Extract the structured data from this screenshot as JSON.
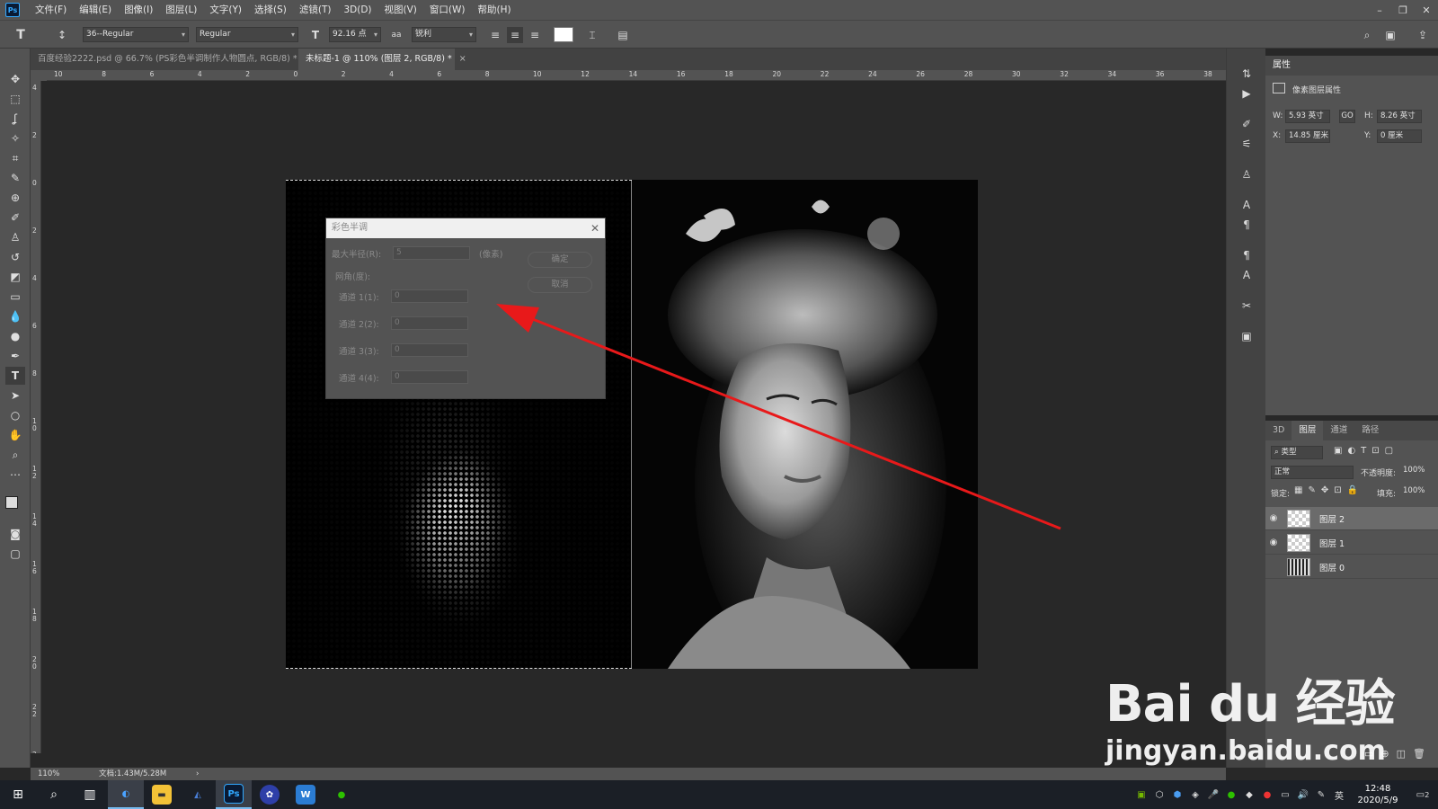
{
  "app": {
    "logo": "Ps",
    "title": ""
  },
  "menu": [
    "文件(F)",
    "编辑(E)",
    "图像(I)",
    "图层(L)",
    "文字(Y)",
    "选择(S)",
    "滤镜(T)",
    "3D(D)",
    "视图(V)",
    "窗口(W)",
    "帮助(H)"
  ],
  "window_controls": {
    "minimize": "–",
    "restore": "❐",
    "close": "✕"
  },
  "options": {
    "font_family": "36--Regular",
    "font_style": "Regular",
    "font_size": "92.16 点",
    "antialias": "锐利",
    "text_color": "#ffffff"
  },
  "tabs": [
    {
      "label": "百度经验2222.psd @ 66.7% (PS彩色半调制作人物圆点, RGB/8) *",
      "close": "×"
    },
    {
      "label": "未标题-1 @ 110% (图层 2, RGB/8) *",
      "close": "×"
    }
  ],
  "ruler": {
    "h_ticks": [
      "10",
      "8",
      "6",
      "4",
      "2",
      "0",
      "2",
      "4",
      "6",
      "8",
      "10",
      "12",
      "14",
      "16",
      "18",
      "20",
      "22",
      "24",
      "26",
      "28",
      "30",
      "32",
      "34",
      "36",
      "38"
    ],
    "v_ticks": [
      "4",
      "2",
      "0",
      "2",
      "4",
      "6",
      "8",
      "1\n0",
      "1\n2",
      "1\n4",
      "1\n6",
      "1\n8",
      "2\n0",
      "2\n2",
      "2\n4"
    ]
  },
  "dialog": {
    "title": "彩色半调",
    "max_radius_label": "最大半径(R):",
    "max_radius_value": "5",
    "unit": "(像素)",
    "angle_label": "网角(度):",
    "channels": [
      {
        "label": "通道 1(1):",
        "value": "0"
      },
      {
        "label": "通道 2(2):",
        "value": "0"
      },
      {
        "label": "通道 3(3):",
        "value": "0"
      },
      {
        "label": "通道 4(4):",
        "value": "0"
      }
    ],
    "ok": "确定",
    "cancel": "取消",
    "close": "✕"
  },
  "properties": {
    "header": "属性",
    "section": "像素图层属性",
    "w_label": "W:",
    "w_value": "5.93 英寸",
    "h_label": "H:",
    "h_value": "8.26 英寸",
    "x_label": "X:",
    "x_value": "14.85 厘米",
    "y_label": "Y:",
    "y_value": "0 厘米",
    "link": "GO"
  },
  "layers_panel": {
    "tabs": [
      "3D",
      "图层",
      "通道",
      "路径"
    ],
    "active_tab": "图层",
    "filter_label": "类型",
    "blend_mode": "正常",
    "opacity_label": "不透明度:",
    "opacity_value": "100%",
    "lock_label": "锁定:",
    "fill_label": "填充:",
    "fill_value": "100%",
    "layers": [
      {
        "name": "图层 2",
        "visible": true,
        "selected": true
      },
      {
        "name": "图层 1",
        "visible": true,
        "selected": false
      },
      {
        "name": "图层 0",
        "visible": false,
        "selected": false
      }
    ]
  },
  "status": {
    "zoom": "110%",
    "doc_info": "文档:1.43M/5.28M",
    "arrow": "›"
  },
  "taskbar": {
    "apps": [
      "start",
      "search",
      "taskview",
      "browser",
      "explorer",
      "word-app",
      "photoshop",
      "baidu-app",
      "word",
      "wechat"
    ],
    "ps_label": "Ps",
    "w_label": "W",
    "time": "12:48",
    "date": "2020/5/9",
    "ime": "英",
    "notifications": "2"
  },
  "watermark": {
    "main": "Bai du 经验",
    "sub": "jingyan.baidu.com"
  },
  "colors": {
    "accent": "#31a8ff",
    "arrow": "#e8191a",
    "panel_bg": "#535353",
    "canvas_bg": "#282828"
  }
}
